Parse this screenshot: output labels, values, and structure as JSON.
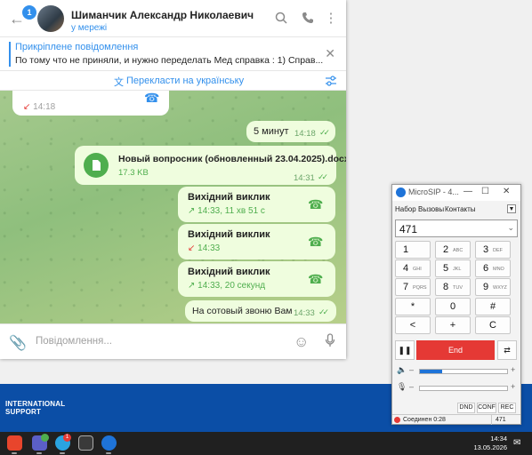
{
  "telegram": {
    "unread_badge": "1",
    "chat_name": "Шиманчик Александр Николаевич",
    "chat_status": "у мережі",
    "pinned_title": "Прикріплене повідомлення",
    "pinned_text": "По тому что не приняли, и нужно переделать Мед справка : 1) Справ...",
    "translate_label": "Перекласти на українську",
    "messages": {
      "partial_in_time": "14:18",
      "msg1_text": "5 минут",
      "msg1_time": "14:18",
      "doc_name": "Новый вопросник (обновленный 23.04.2025).docx",
      "doc_size": "17.3 KB",
      "doc_time": "14:31",
      "call1_title": "Вихідний виклик",
      "call1_sub": "14:33, 11 хв 51 с",
      "call2_title": "Вихідний виклик",
      "call2_sub": "14:33",
      "call3_title": "Вихідний виклик",
      "call3_sub": "14:33, 20 секунд",
      "msg2_text": "На сотовый звоню Вам",
      "msg2_time": "14:33"
    },
    "composer_placeholder": "Повідомлення..."
  },
  "microsip": {
    "title": "MicroSIP - 4...",
    "tabs": [
      "Набор",
      "Вызовы",
      "Контакты"
    ],
    "number": "471",
    "keys": [
      {
        "d": "1",
        "l": ""
      },
      {
        "d": "2",
        "l": "ABC"
      },
      {
        "d": "3",
        "l": "DEF"
      },
      {
        "d": "4",
        "l": "GHI"
      },
      {
        "d": "5",
        "l": "JKL"
      },
      {
        "d": "6",
        "l": "MNO"
      },
      {
        "d": "7",
        "l": "PQRS"
      },
      {
        "d": "8",
        "l": "TUV"
      },
      {
        "d": "9",
        "l": "WXYZ"
      },
      {
        "d": "*",
        "l": ""
      },
      {
        "d": "0",
        "l": ""
      },
      {
        "d": "#",
        "l": ""
      },
      {
        "d": "<",
        "l": ""
      },
      {
        "d": "+",
        "l": ""
      },
      {
        "d": "C",
        "l": ""
      }
    ],
    "end_label": "End",
    "speaker_level": 0.25,
    "mic_level": 0.0,
    "btn_dnd": "DND",
    "btn_conf": "CONF",
    "btn_rec": "REC",
    "status_text": "Соединен 0:28",
    "status_number": "471"
  },
  "desktop": {
    "brand_line1": "INTERNATIONAL",
    "brand_line2": "SUPPORT"
  },
  "taskbar": {
    "time": "14:34",
    "date": "13.05.2026",
    "telegram_badge": "1"
  }
}
